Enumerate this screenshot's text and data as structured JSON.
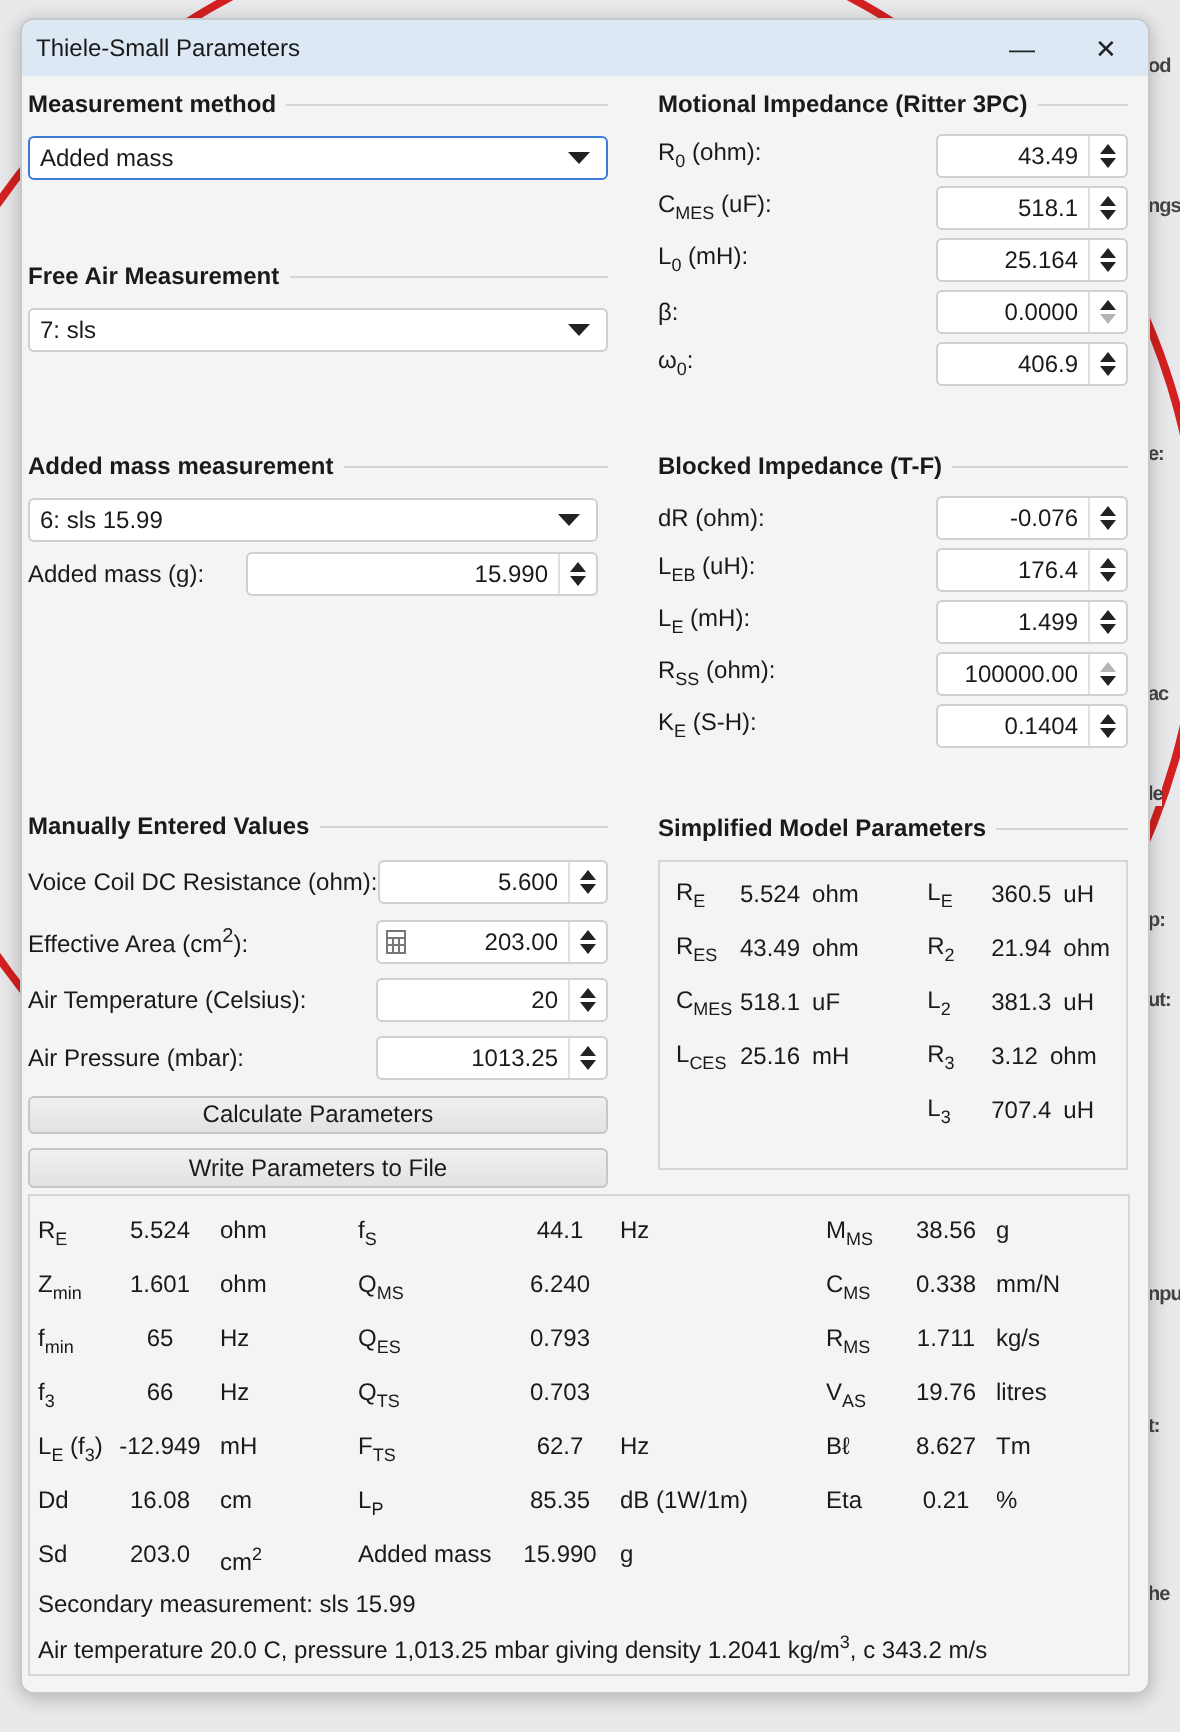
{
  "background": {
    "fragments": [
      "od",
      "ngs",
      "e:",
      "ac",
      "le",
      "p:",
      "ut:",
      "npu",
      "t:",
      "he"
    ]
  },
  "window": {
    "title": "Thiele-Small Parameters",
    "minimize": "—",
    "close": "✕"
  },
  "measurement_method": {
    "title": "Measurement method",
    "dropdown": {
      "value": "Added mass",
      "focused": true
    }
  },
  "free_air": {
    "title": "Free Air Measurement",
    "dropdown": {
      "value": "7: sls",
      "focused": false
    }
  },
  "added_mass_measurement": {
    "title": "Added mass measurement",
    "dropdown": {
      "value": "6: sls 15.99",
      "focused": false
    },
    "field": {
      "label": "Added mass (g):",
      "value": "15.990",
      "up_disabled": false,
      "down_disabled": false
    }
  },
  "motional_impedance": {
    "title": "Motional Impedance (Ritter 3PC)",
    "fields": [
      {
        "label": "R$_{0}$ (ohm):",
        "value": "43.49",
        "up_disabled": false,
        "down_disabled": false
      },
      {
        "label": "C$_{MES}$ (uF):",
        "value": "518.1",
        "up_disabled": false,
        "down_disabled": false
      },
      {
        "label": "L$_{0}$ (mH):",
        "value": "25.164",
        "up_disabled": false,
        "down_disabled": false
      },
      {
        "label": "β:",
        "value": "0.0000",
        "up_disabled": false,
        "down_disabled": true
      },
      {
        "label": "ω$_{0}$:",
        "value": "406.9",
        "up_disabled": false,
        "down_disabled": false
      }
    ]
  },
  "blocked_impedance": {
    "title": "Blocked Impedance (T-F)",
    "fields": [
      {
        "label": "dR (ohm):",
        "value": "-0.076",
        "up_disabled": false,
        "down_disabled": false
      },
      {
        "label": "L$_{EB}$ (uH):",
        "value": "176.4",
        "up_disabled": false,
        "down_disabled": false
      },
      {
        "label": "L$_{E}$ (mH):",
        "value": "1.499",
        "up_disabled": false,
        "down_disabled": false
      },
      {
        "label": "R$_{SS}$ (ohm):",
        "value": "100000.00",
        "up_disabled": true,
        "down_disabled": false
      },
      {
        "label": "K$_{E}$ (S-H):",
        "value": "0.1404",
        "up_disabled": false,
        "down_disabled": false
      }
    ]
  },
  "manual_values": {
    "title": "Manually Entered Values",
    "fields": [
      {
        "label": "Voice Coil DC Resistance (ohm):",
        "value": "5.600",
        "calculator": false,
        "up_disabled": false,
        "down_disabled": false
      },
      {
        "label": "Effective Area (cm$^{2}$):",
        "value": "203.00",
        "calculator": true,
        "up_disabled": false,
        "down_disabled": false
      },
      {
        "label": "Air Temperature (Celsius):",
        "value": "20",
        "calculator": false,
        "up_disabled": false,
        "down_disabled": false
      },
      {
        "label": "Air Pressure (mbar):",
        "value": "1013.25",
        "calculator": false,
        "up_disabled": false,
        "down_disabled": false
      }
    ],
    "buttons": [
      "Calculate Parameters",
      "Write Parameters to File"
    ]
  },
  "simplified_model": {
    "title": "Simplified Model Parameters",
    "columns": [
      [
        {
          "symbol": "R$_{E}$",
          "value": "5.524",
          "unit": "ohm"
        },
        {
          "symbol": "R$_{ES}$",
          "value": "43.49",
          "unit": "ohm"
        },
        {
          "symbol": "C$_{MES}$",
          "value": "518.1",
          "unit": "uF"
        },
        {
          "symbol": "L$_{CES}$",
          "value": "25.16",
          "unit": "mH"
        }
      ],
      [
        {
          "symbol": "L$_{E}$",
          "value": "360.5",
          "unit": "uH"
        },
        {
          "symbol": "R$_{2}$",
          "value": "21.94",
          "unit": "ohm"
        },
        {
          "symbol": "L$_{2}$",
          "value": "381.3",
          "unit": "uH"
        },
        {
          "symbol": "R$_{3}$",
          "value": "3.12",
          "unit": "ohm"
        },
        {
          "symbol": "L$_{3}$",
          "value": "707.4",
          "unit": "uH"
        }
      ]
    ]
  },
  "results": {
    "rows": [
      [
        {
          "symbol": "R$_{E}$",
          "value": "5.524",
          "unit": "ohm"
        },
        {
          "symbol": "f$_{S}$",
          "value": "44.1",
          "unit": "Hz"
        },
        {
          "symbol": "M$_{MS}$",
          "value": "38.56",
          "unit": "g"
        }
      ],
      [
        {
          "symbol": "Z$_{min}$",
          "value": "1.601",
          "unit": "ohm"
        },
        {
          "symbol": "Q$_{MS}$",
          "value": "6.240"
        },
        {
          "symbol": "C$_{MS}$",
          "value": "0.338",
          "unit": "mm/N"
        }
      ],
      [
        {
          "symbol": "f$_{min}$",
          "value": "65",
          "unit": "Hz"
        },
        {
          "symbol": "Q$_{ES}$",
          "value": "0.793"
        },
        {
          "symbol": "R$_{MS}$",
          "value": "1.711",
          "unit": "kg/s"
        }
      ],
      [
        {
          "symbol": "f$_{3}$",
          "value": "66",
          "unit": "Hz"
        },
        {
          "symbol": "Q$_{TS}$",
          "value": "0.703"
        },
        {
          "symbol": "V$_{AS}$",
          "value": "19.76",
          "unit": "litres"
        }
      ],
      [
        {
          "symbol": "L$_{E}$ (f$_{3}$)",
          "value": "-12.949",
          "unit": "mH"
        },
        {
          "symbol": "F$_{TS}$",
          "value": "62.7",
          "unit": "Hz"
        },
        {
          "symbol": "Bℓ",
          "value": "8.627",
          "unit": "Tm"
        }
      ],
      [
        {
          "symbol": "Dd",
          "value": "16.08",
          "unit": "cm"
        },
        {
          "symbol": "L$_{P}$",
          "value": "85.35",
          "unit": "dB (1W/1m)"
        },
        {
          "symbol": "Eta",
          "value": "0.21",
          "unit": "%"
        }
      ],
      [
        {
          "symbol": "Sd",
          "value": "203.0",
          "unit": "cm$^{2}$"
        },
        {
          "symbol": "Added mass",
          "value": "15.990",
          "unit": "g"
        }
      ]
    ],
    "notes": [
      "Secondary measurement: sls 15.99",
      "Air temperature 20.0 C, pressure 1,013.25 mbar giving density 1.2041 kg/m$^{3}$, c 343.2 m/s"
    ]
  }
}
